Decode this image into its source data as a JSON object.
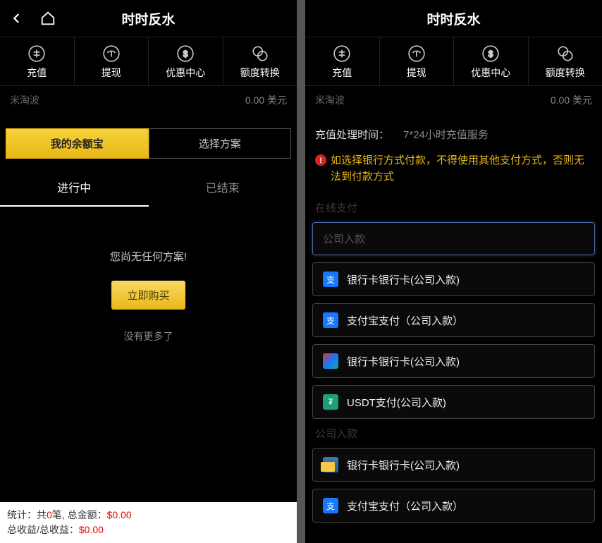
{
  "left": {
    "header": {
      "title": "时时反水"
    },
    "nav": [
      {
        "label": "充值"
      },
      {
        "label": "提现"
      },
      {
        "label": "优惠中心"
      },
      {
        "label": "额度转换"
      }
    ],
    "balance": {
      "user": "米淘波",
      "amount": "0.00 美元"
    },
    "tabs": {
      "active": "我的余额宝",
      "inactive": "选择方案"
    },
    "subtabs": {
      "active": "进行中",
      "inactive": "已结束"
    },
    "empty": {
      "msg": "您尚无任何方案!",
      "buy": "立即购买",
      "nomore": "没有更多了"
    },
    "footer": {
      "line1_a": "统计：共",
      "line1_b": "0",
      "line1_c": "笔, 总金额：",
      "line1_d": "$0.00",
      "line2_a": "总收益/总收益：",
      "line2_b": "$0.00"
    }
  },
  "right": {
    "header": {
      "title": "时时反水"
    },
    "nav": [
      {
        "label": "充值"
      },
      {
        "label": "提现"
      },
      {
        "label": "优惠中心"
      },
      {
        "label": "额度转换"
      }
    ],
    "balance": {
      "user": "米淘波",
      "amount": "0.00 美元"
    },
    "info": {
      "label": "充值处理时间：",
      "val": "7*24小时充值服务"
    },
    "warning": "如选择银行方式付款，不得使用其他支付方式，否则无法到付款方式",
    "section1": "在线支付",
    "pay_select": "公司入款",
    "items1": [
      {
        "icon": "alipay",
        "label": "银行卡银行卡(公司入款)"
      },
      {
        "icon": "alipay",
        "label": "支付宝支付（公司入款）"
      },
      {
        "icon": "union",
        "label": "银行卡银行卡(公司入款)"
      },
      {
        "icon": "usdt",
        "label": "USDT支付(公司入款)"
      }
    ],
    "section2": "公司入款",
    "items2": [
      {
        "icon": "card",
        "label": "银行卡银行卡(公司入款)"
      },
      {
        "icon": "alipay",
        "label": "支付宝支付（公司入款）"
      }
    ]
  }
}
